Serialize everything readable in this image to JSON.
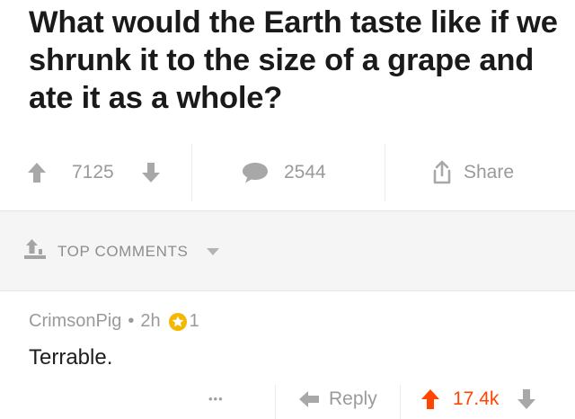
{
  "post": {
    "title": "What would the Earth taste like if we shrunk it to the size of a grape and ate it as a whole?",
    "votes": "7125",
    "comments": "2544",
    "share_label": "Share"
  },
  "sort": {
    "label": "TOP COMMENTS"
  },
  "comment": {
    "author": "CrimsonPig",
    "dot": "•",
    "age": "2h",
    "award_count": "1",
    "text": "Terrable.",
    "more": "•••",
    "reply_label": "Reply",
    "score": "17.4k"
  },
  "colors": {
    "upvoted": "#ff4500",
    "award": "#f5b800",
    "muted": "#9a9a9a"
  }
}
